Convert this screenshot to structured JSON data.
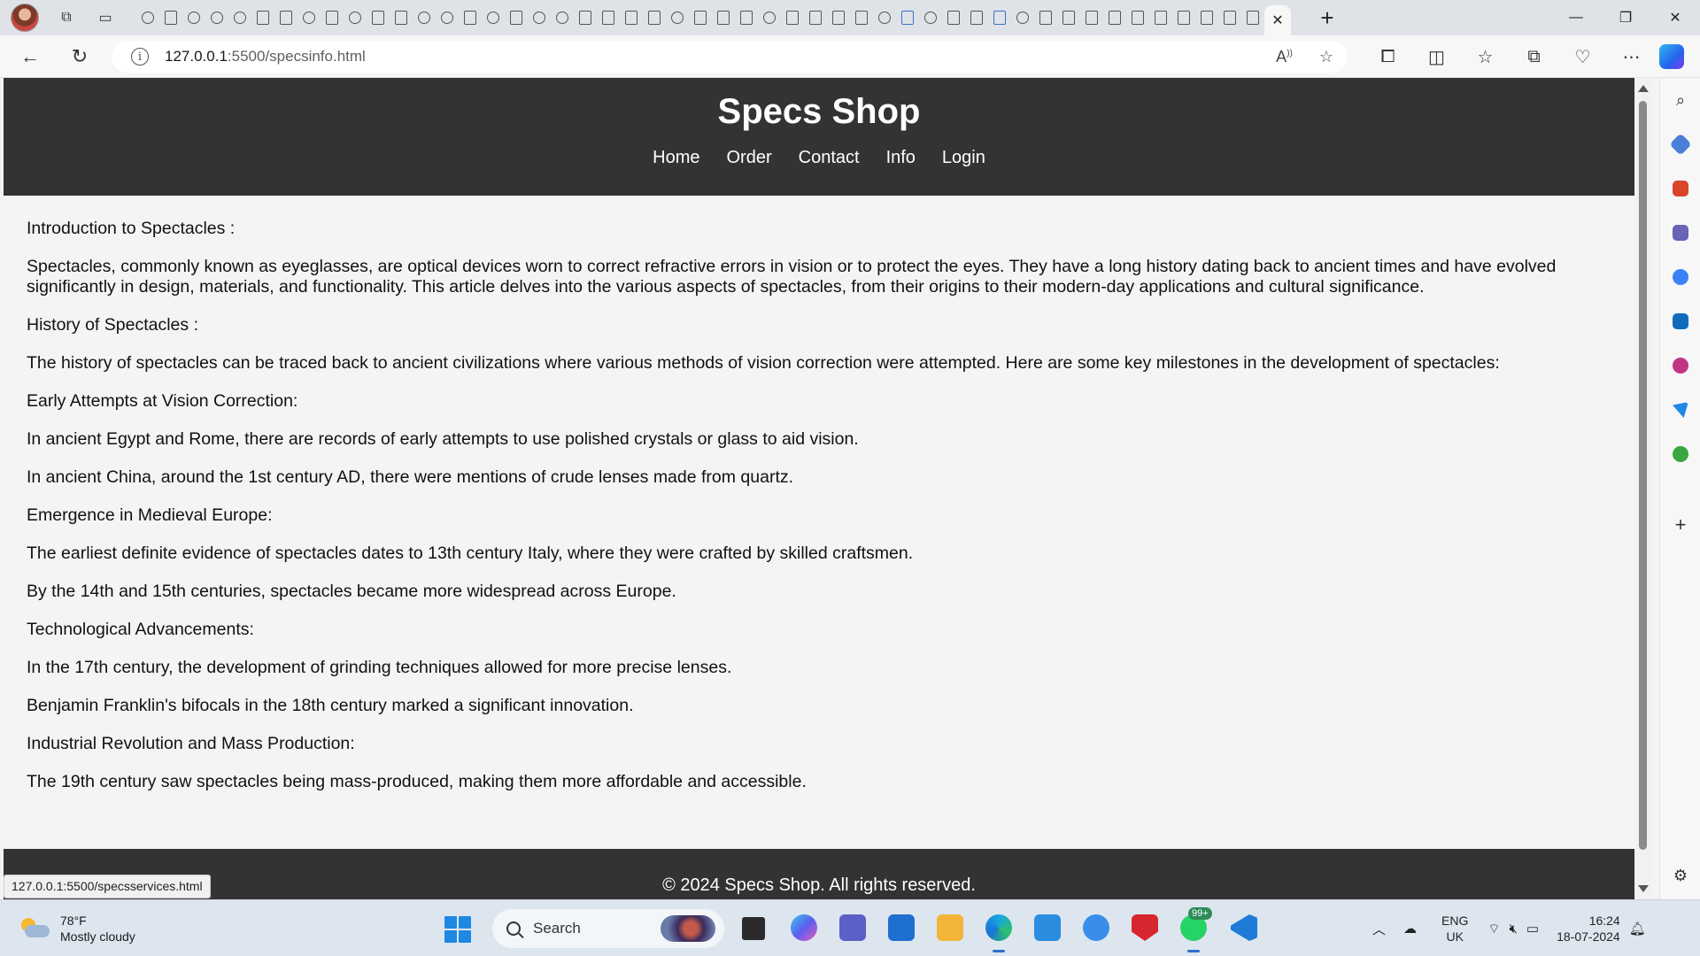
{
  "browser": {
    "address": {
      "host": "127.0.0.1",
      "path": ":5500/specsinfo.html"
    },
    "status_url": "127.0.0.1:5500/specsservices.html",
    "window_controls": {
      "minimize": "—",
      "maximize": "❐",
      "close": "✕"
    }
  },
  "site": {
    "title": "Specs Shop",
    "nav": [
      "Home",
      "Order",
      "Contact",
      "Info",
      "Login"
    ],
    "footer": "© 2024 Specs Shop. All rights reserved."
  },
  "content": {
    "paragraphs": [
      "Introduction to Spectacles :",
      "Spectacles, commonly known as eyeglasses, are optical devices worn to correct refractive errors in vision or to protect the eyes. They have a long history dating back to ancient times and have evolved significantly in design, materials, and functionality. This article delves into the various aspects of spectacles, from their origins to their modern-day applications and cultural significance.",
      "History of Spectacles :",
      "The history of spectacles can be traced back to ancient civilizations where various methods of vision correction were attempted. Here are some key milestones in the development of spectacles:",
      "Early Attempts at Vision Correction:",
      "In ancient Egypt and Rome, there are records of early attempts to use polished crystals or glass to aid vision.",
      "In ancient China, around the 1st century AD, there were mentions of crude lenses made from quartz.",
      "Emergence in Medieval Europe:",
      "The earliest definite evidence of spectacles dates to 13th century Italy, where they were crafted by skilled craftsmen.",
      "By the 14th and 15th centuries, spectacles became more widespread across Europe.",
      "Technological Advancements:",
      "In the 17th century, the development of grinding techniques allowed for more precise lenses.",
      "Benjamin Franklin's bifocals in the 18th century marked a significant innovation.",
      "Industrial Revolution and Mass Production:",
      "The 19th century saw spectacles being mass-produced, making them more affordable and accessible."
    ]
  },
  "taskbar": {
    "weather": {
      "temp": "78°F",
      "condition": "Mostly cloudy"
    },
    "search_label": "Search",
    "badge": "99+",
    "language": {
      "lang": "ENG",
      "region": "UK"
    },
    "time": "16:24",
    "date": "18-07-2024"
  },
  "colors": {
    "header_bg": "#333333",
    "page_bg": "#f4f4f4",
    "footer_bg": "#333333",
    "accent": "#2a6fd0"
  }
}
